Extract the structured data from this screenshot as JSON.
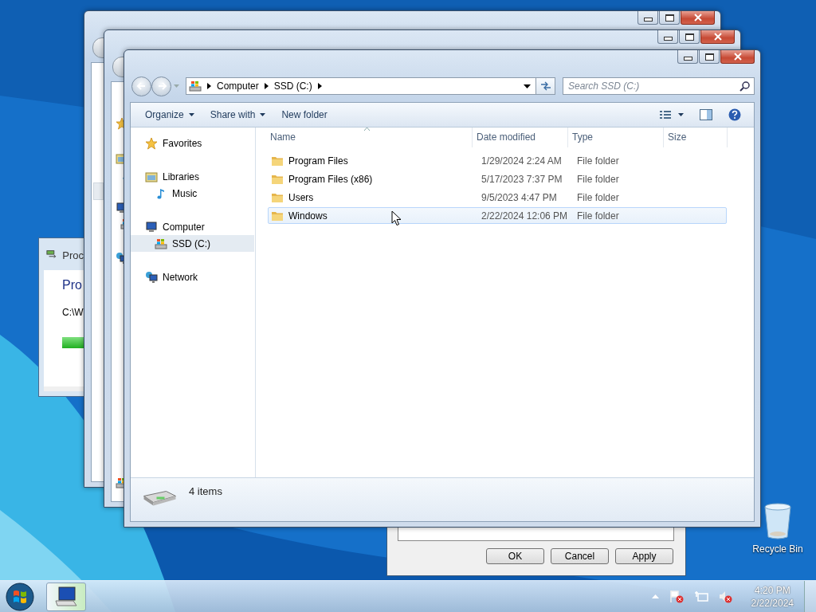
{
  "desktop": {
    "icons": [
      {
        "label": "Recycle Bin"
      }
    ]
  },
  "progress_dialog": {
    "title": "Proc",
    "heading": "Pro",
    "path": "C:\\W"
  },
  "properties_dialog": {
    "buttons": [
      "OK",
      "Cancel",
      "Apply"
    ]
  },
  "explorer": {
    "breadcrumbs": [
      "Computer",
      "SSD (C:)"
    ],
    "search": {
      "placeholder": "Search SSD (C:)"
    },
    "toolbar": [
      {
        "label": "Organize",
        "dropdown": true
      },
      {
        "label": "Share with",
        "dropdown": true
      },
      {
        "label": "New folder",
        "dropdown": false
      }
    ],
    "nav": [
      {
        "label": "Favorites",
        "kind": "favorites",
        "selected": false
      },
      {
        "label": "Libraries",
        "kind": "library",
        "selected": false,
        "children": [
          {
            "label": "Music",
            "kind": "music",
            "selected": false
          }
        ]
      },
      {
        "label": "Computer",
        "kind": "computer",
        "selected": false,
        "children": [
          {
            "label": "SSD (C:)",
            "kind": "drive",
            "selected": true
          }
        ]
      },
      {
        "label": "Network",
        "kind": "network",
        "selected": false
      }
    ],
    "columns": [
      {
        "label": "Name",
        "sorted": true
      },
      {
        "label": "Date modified",
        "sorted": false
      },
      {
        "label": "Type",
        "sorted": false
      },
      {
        "label": "Size",
        "sorted": false
      }
    ],
    "rows": [
      {
        "name": "Program Files",
        "date": "1/29/2024 2:24 AM",
        "type": "File folder",
        "selected": false
      },
      {
        "name": "Program Files (x86)",
        "date": "5/17/2023 7:37 PM",
        "type": "File folder",
        "selected": false
      },
      {
        "name": "Users",
        "date": "9/5/2023 4:47 PM",
        "type": "File folder",
        "selected": false
      },
      {
        "name": "Windows",
        "date": "2/22/2024 12:06 PM",
        "type": "File folder",
        "selected": true
      }
    ],
    "status": "4 items"
  },
  "taskbar": {
    "clock_time": "4:20 PM",
    "clock_date": "2/22/2024"
  }
}
